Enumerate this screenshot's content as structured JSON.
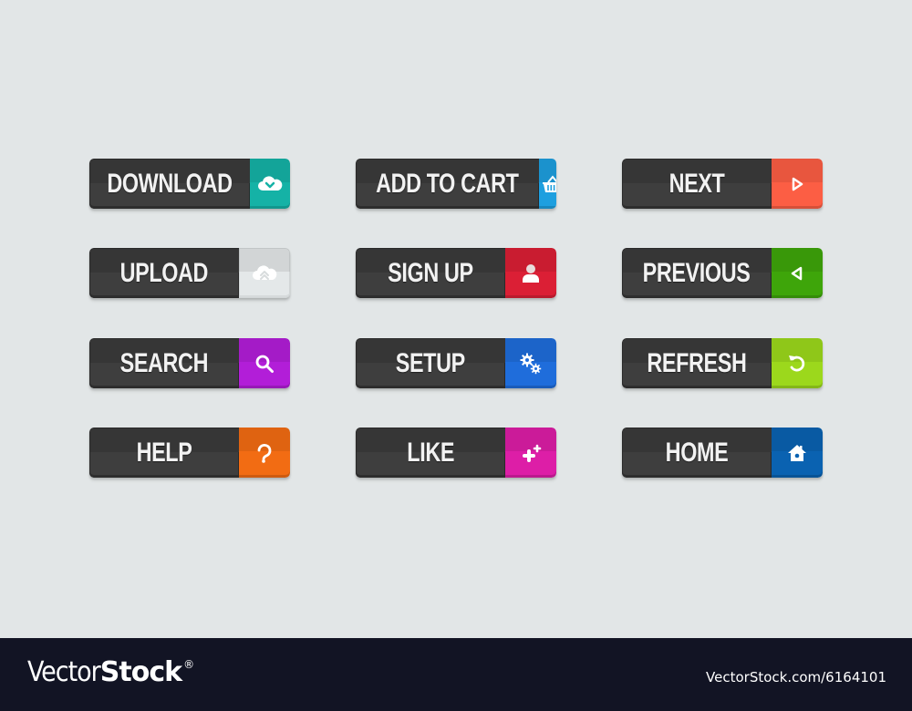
{
  "buttons": [
    {
      "label": "DOWNLOAD",
      "icon": "cloud-download-icon",
      "color": "#15b2a6"
    },
    {
      "label": "ADD TO CART",
      "icon": "basket-icon",
      "color": "#1e9fdf"
    },
    {
      "label": "NEXT",
      "icon": "play-right-icon",
      "color": "#fc5e44"
    },
    {
      "label": "UPLOAD",
      "icon": "cloud-upload-icon",
      "color": "#e4e8e9"
    },
    {
      "label": "SIGN UP",
      "icon": "user-icon",
      "color": "#db1f35"
    },
    {
      "label": "PREVIOUS",
      "icon": "play-left-icon",
      "color": "#3ea50a"
    },
    {
      "label": "SEARCH",
      "icon": "search-icon",
      "color": "#b21ed8"
    },
    {
      "label": "SETUP",
      "icon": "gears-icon",
      "color": "#1f6ddb"
    },
    {
      "label": "REFRESH",
      "icon": "refresh-icon",
      "color": "#9cd81c"
    },
    {
      "label": "HELP",
      "icon": "question-icon",
      "color": "#f26c13"
    },
    {
      "label": "LIKE",
      "icon": "plus-one-icon",
      "color": "#dd1ea7"
    },
    {
      "label": "HOME",
      "icon": "home-icon",
      "color": "#0a62b1"
    }
  ],
  "footer": {
    "logo_light": "Vector",
    "logo_bold": "Stock",
    "logo_mark": "®",
    "reference": "VectorStock.com/6164101"
  }
}
